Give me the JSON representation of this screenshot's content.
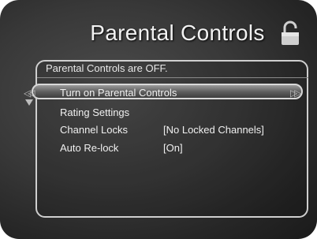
{
  "screen": {
    "title": "Parental Controls",
    "status_text": "Parental Controls are OFF."
  },
  "icons": {
    "lock": "unlocked-padlock-icon",
    "left_arrows": "double-chevron-left-icon",
    "right_arrows": "double-chevron-right-icon",
    "down_arrow": "triangle-down-icon"
  },
  "menu": {
    "items": [
      {
        "label": "Turn on Parental Controls",
        "value": "",
        "selected": true
      },
      {
        "label": "Rating Settings",
        "value": ""
      },
      {
        "label": "Channel Locks",
        "value": "[No Locked Channels]"
      },
      {
        "label": "Auto Re-lock",
        "value": "[On]"
      }
    ]
  },
  "glyphs": {
    "left": "◁◁",
    "right": "▷▷"
  }
}
